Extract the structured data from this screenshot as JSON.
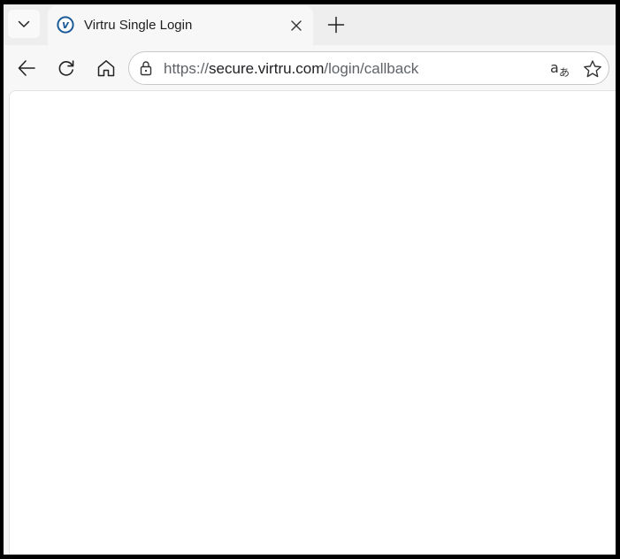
{
  "tab": {
    "title": "Virtru Single Login",
    "favicon_letter": "v",
    "favicon_color": "#1a5a96"
  },
  "toolbar": {
    "address": {
      "scheme": "https://",
      "host": "secure.virtru.com",
      "path": "/login/callback"
    }
  },
  "icons": {
    "tab_menu": "chevron-down-icon",
    "close": "close-icon",
    "new_tab": "plus-icon",
    "back": "back-arrow-icon",
    "reload": "reload-icon",
    "home": "home-icon",
    "lock": "lock-icon",
    "translate": "translate-icon",
    "favorite": "star-icon"
  },
  "colors": {
    "frame": "#000000",
    "tabstrip": "#eeeeee",
    "toolbar": "#f7f7f7",
    "page_background": "#ffffff"
  }
}
